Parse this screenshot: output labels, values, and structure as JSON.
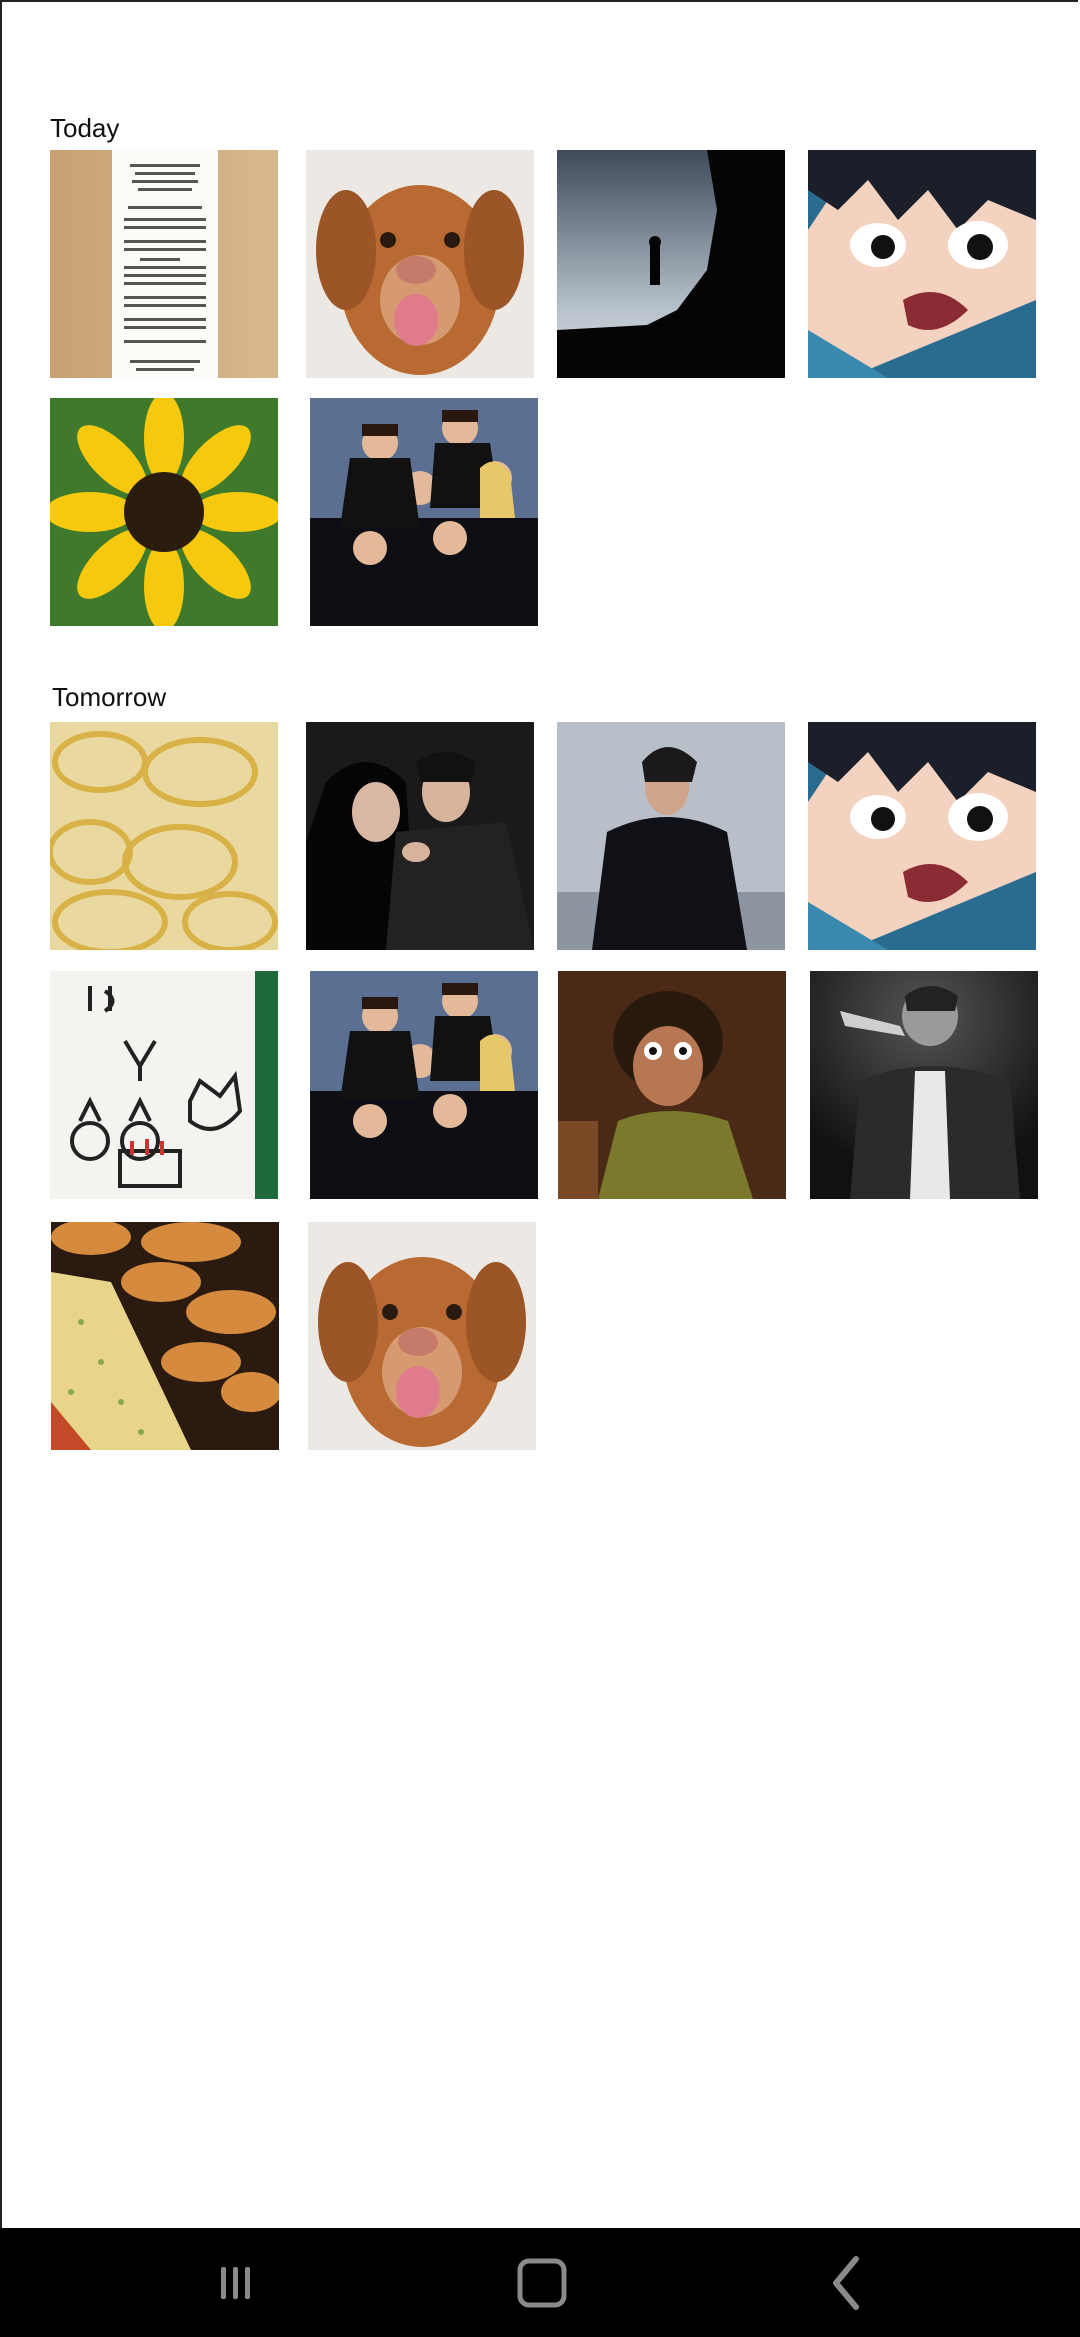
{
  "sections": [
    {
      "title": "Today",
      "photos": [
        "receipt",
        "dog",
        "silhouette",
        "anime-boy",
        "sunflower",
        "friends-group"
      ]
    },
    {
      "title": "Tomorrow",
      "photos": [
        "pasta",
        "couple",
        "man-portrait",
        "anime-boy",
        "birthday-card",
        "friends-group",
        "animated-boy",
        "singer",
        "pastries",
        "dog"
      ]
    }
  ],
  "navbar": {
    "icons": [
      "recent-apps-icon",
      "home-icon",
      "back-icon"
    ]
  }
}
